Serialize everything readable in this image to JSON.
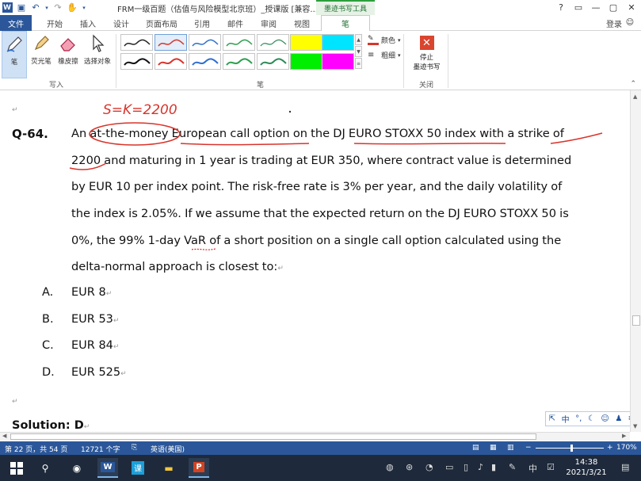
{
  "window": {
    "title": "FRM一级百题（估值与风险模型北京班）_授课版 [兼容...",
    "context_label": "墨迹书写工具",
    "controls": [
      "?",
      "▭",
      "—",
      "▢",
      "✕"
    ]
  },
  "tabs": [
    "文件",
    "开始",
    "插入",
    "设计",
    "页面布局",
    "引用",
    "邮件",
    "审阅",
    "视图",
    "笔"
  ],
  "login": "登录",
  "ribbon": {
    "tools": [
      "笔",
      "荧光笔",
      "橡皮擦",
      "选择对象"
    ],
    "group_write": "写入",
    "group_pens": "笔",
    "color_label": "颜色",
    "thickness_label": "粗细",
    "stop_label_1": "停止",
    "stop_label_2": "墨迹书写",
    "group_close": "关闭",
    "pen_colors": [
      "#222222",
      "#d9342b",
      "#2f6fd0",
      "#2e9e4e",
      "#2e8b57",
      "#ffff00",
      "#00e5ff",
      "#111111",
      "#d9342b",
      "#2f6fd0",
      "#2e9e4e",
      "#2e8b57",
      "#00ee00",
      "#ff00ff"
    ]
  },
  "document": {
    "question_id": "Q-64.",
    "lines": [
      "An at-the-money European call option on the DJ EURO STOXX 50 index with a strike of",
      "2200 and maturing in 1 year is trading at EUR 350, where contract value is determined",
      "by EUR 10 per index point. The risk-free rate is 3% per year, and the daily volatility of",
      "the index is 2.05%. If we assume that the expected return on the DJ EURO STOXX 50 is",
      "0%, the 99% 1-day VaR of a short position on a single call option calculated using the",
      "delta-normal approach is closest to:"
    ],
    "options": [
      {
        "letter": "A.",
        "text": "EUR 8"
      },
      {
        "letter": "B.",
        "text": "EUR 53"
      },
      {
        "letter": "C.",
        "text": "EUR 84"
      },
      {
        "letter": "D.",
        "text": "EUR 525"
      }
    ],
    "solution": "Solution: D",
    "handwriting": "S=K=2200"
  },
  "statusbar": {
    "page": "第 22 页，共 54 页",
    "words": "12721 个字",
    "lang": "英语(美国)",
    "zoom": "170%",
    "zoom_level": 170
  },
  "ime": {
    "lang": "中"
  },
  "taskbar": {
    "time": "14:38",
    "date": "2021/3/21",
    "ime": "中"
  },
  "colors": {
    "accent": "#2b579a",
    "ink": "#d9342b",
    "stop": "#d9452f"
  }
}
